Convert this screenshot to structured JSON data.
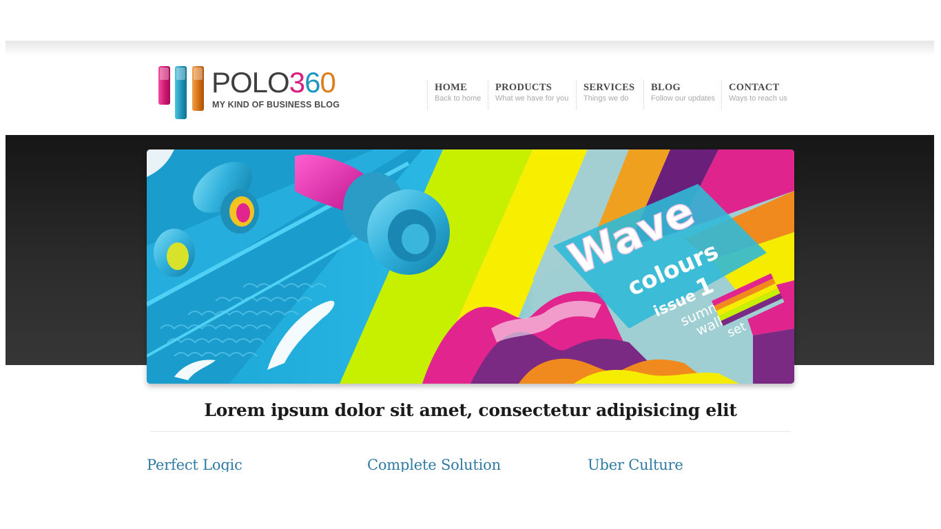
{
  "brand": {
    "name_part1": "POLO",
    "name_digit1": "3",
    "name_digit2": "6",
    "name_digit3": "0",
    "tagline": "MY KIND OF BUSINESS BLOG",
    "colors": {
      "pink": "#d81e7e",
      "blue": "#1e97c2",
      "orange": "#dd7e1c"
    }
  },
  "nav": [
    {
      "label": "HOME",
      "sub": "Back to home"
    },
    {
      "label": "PRODUCTS",
      "sub": "What we have for you"
    },
    {
      "label": "SERVICES",
      "sub": "Things we do"
    },
    {
      "label": "BLOG",
      "sub": "Follow our updates"
    },
    {
      "label": "CONTACT",
      "sub": "Ways to reach us"
    }
  ],
  "slider": {
    "word1": "Wave",
    "word2": "colours",
    "word3": "issue",
    "word4": "1",
    "word5": "summer",
    "word6": "wallpaper",
    "word7": "set"
  },
  "headline": "Lorem ipsum dolor sit amet, consectetur adipisicing elit",
  "features": [
    "Perfect Logic",
    "Complete Solution",
    "Uber Culture"
  ]
}
